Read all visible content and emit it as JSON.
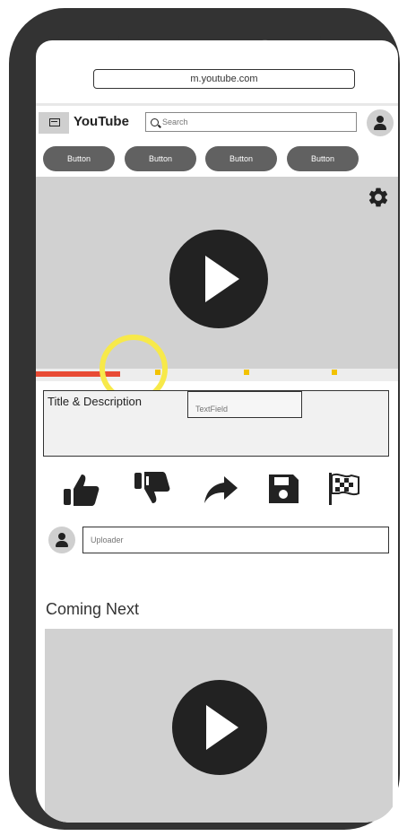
{
  "browser": {
    "url": "m.youtube.com"
  },
  "header": {
    "brand": "YouTube",
    "search_placeholder": "Search",
    "logo_icon": "youtube-logo-icon",
    "avatar_icon": "user-icon"
  },
  "chips": [
    {
      "label": "Button"
    },
    {
      "label": "Button"
    },
    {
      "label": "Button"
    },
    {
      "label": "Button"
    }
  ],
  "player": {
    "settings_icon": "gear-icon",
    "play_icon": "play-icon",
    "progress_fraction": 0.23,
    "progress_color": "#e84b35",
    "marker_color": "#f2c200",
    "highlight_color": "#f7e94a"
  },
  "details": {
    "title": "Title & Description",
    "textfield_placeholder": "TextField"
  },
  "actions": [
    {
      "icon": "thumbs-up-icon"
    },
    {
      "icon": "thumbs-down-icon"
    },
    {
      "icon": "share-icon"
    },
    {
      "icon": "save-icon"
    },
    {
      "icon": "report-flag-icon"
    }
  ],
  "uploader": {
    "placeholder": "Uploader",
    "avatar_icon": "user-icon"
  },
  "coming_next": {
    "heading": "Coming Next",
    "play_icon": "play-icon"
  },
  "colors": {
    "frame": "#333333",
    "chip": "#616161",
    "video_bg": "#d1d1d1"
  }
}
